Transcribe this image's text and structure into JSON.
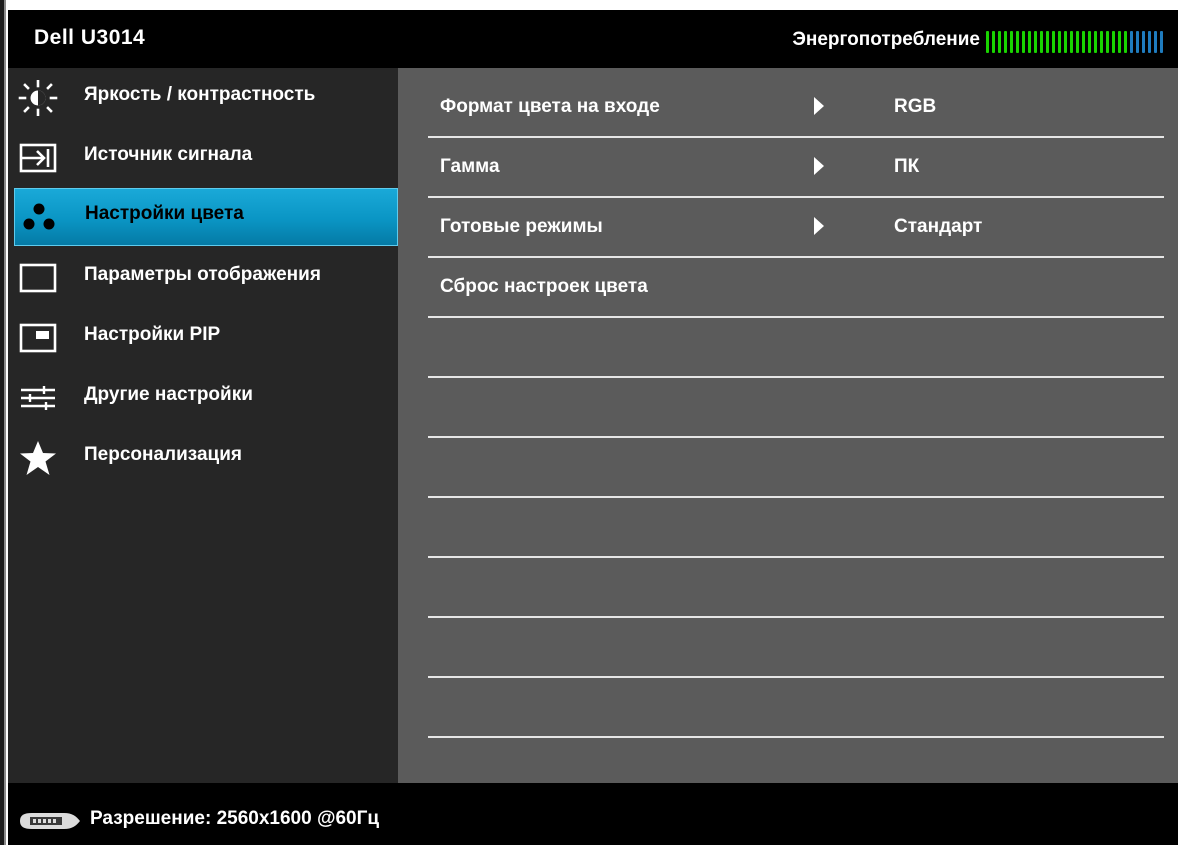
{
  "header": {
    "model": "Dell U3014",
    "energy_label": "Энергопотребление",
    "energy_level_fraction": 0.8,
    "energy_active_color": "#19d400",
    "energy_inactive_color": "#1f7cbf"
  },
  "sidebar": {
    "items": [
      {
        "label": "Яркость / контрастность",
        "icon": "brightness-icon",
        "active": false
      },
      {
        "label": "Источник сигнала",
        "icon": "input-source-icon",
        "active": false
      },
      {
        "label": "Настройки цвета",
        "icon": "color-dots-icon",
        "active": true
      },
      {
        "label": "Параметры отображения",
        "icon": "display-rect-icon",
        "active": false
      },
      {
        "label": "Настройки PIP",
        "icon": "pip-icon",
        "active": false
      },
      {
        "label": "Другие настройки",
        "icon": "sliders-icon",
        "active": false
      },
      {
        "label": "Персонализация",
        "icon": "star-icon",
        "active": false
      }
    ]
  },
  "content": {
    "rows": [
      {
        "label": "Формат цвета на входе",
        "value": "RGB",
        "has_arrow": true
      },
      {
        "label": "Гамма",
        "value": "ПК",
        "has_arrow": true
      },
      {
        "label": "Готовые режимы",
        "value": "Стандарт",
        "has_arrow": true
      },
      {
        "label": "Сброс настроек цвета",
        "value": "",
        "has_arrow": false
      },
      {
        "label": "",
        "value": "",
        "has_arrow": false
      },
      {
        "label": "",
        "value": "",
        "has_arrow": false
      },
      {
        "label": "",
        "value": "",
        "has_arrow": false
      },
      {
        "label": "",
        "value": "",
        "has_arrow": false
      },
      {
        "label": "",
        "value": "",
        "has_arrow": false
      },
      {
        "label": "",
        "value": "",
        "has_arrow": false
      },
      {
        "label": "",
        "value": "",
        "has_arrow": false
      }
    ]
  },
  "footer": {
    "resolution_text": "Разрешение: 2560x1600 @60Гц",
    "icon": "connector-icon"
  }
}
